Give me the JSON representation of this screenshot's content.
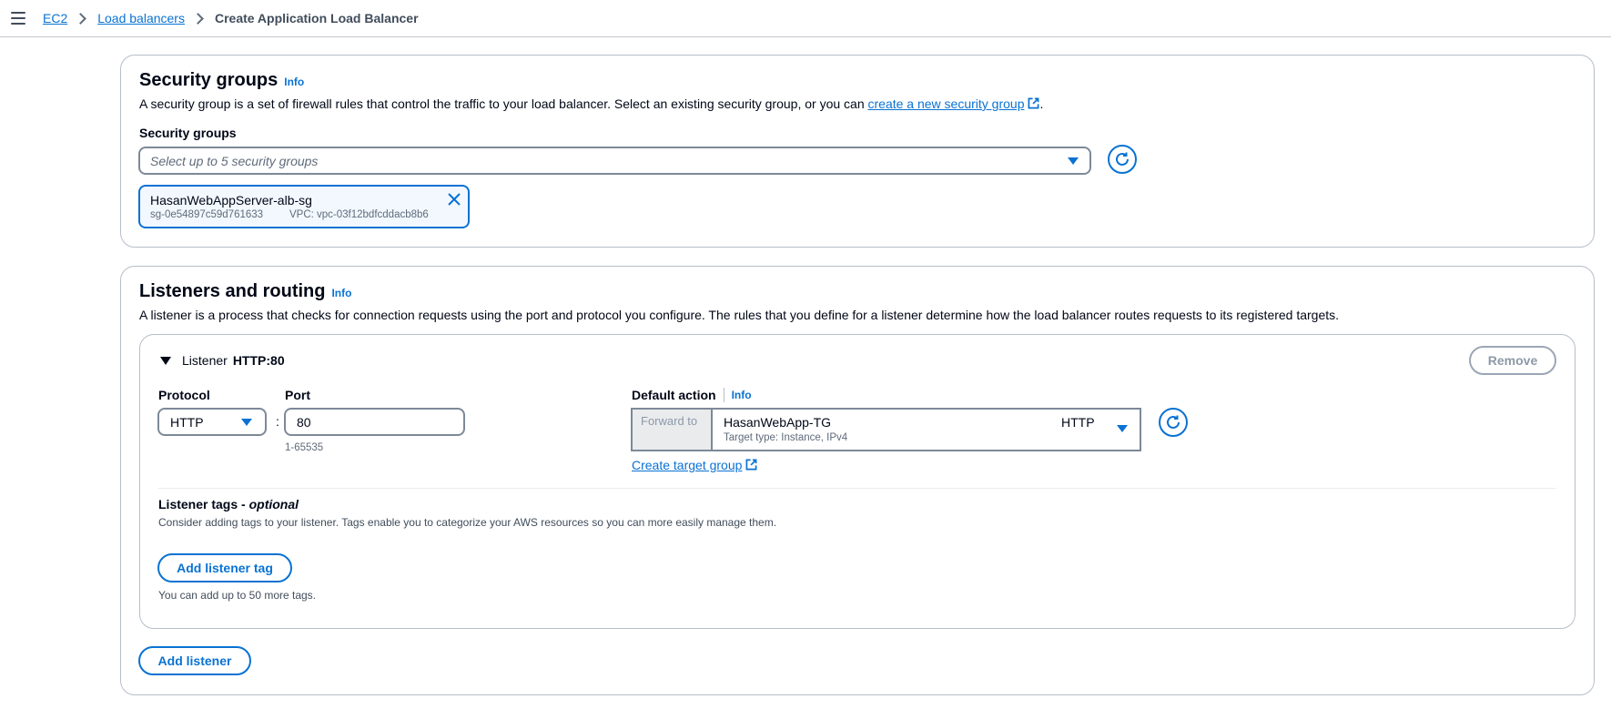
{
  "breadcrumb": {
    "items": [
      "EC2",
      "Load balancers"
    ],
    "current": "Create Application Load Balancer"
  },
  "security_groups": {
    "title": "Security groups",
    "info": "Info",
    "description_prefix": "A security group is a set of firewall rules that control the traffic to your load balancer. Select an existing security group, or you can ",
    "description_link": "create a new security group",
    "description_suffix": ".",
    "field_label": "Security groups",
    "placeholder": "Select up to 5 security groups",
    "selected": [
      {
        "name": "HasanWebAppServer-alb-sg",
        "id": "sg-0e54897c59d761633",
        "vpc": "VPC: vpc-03f12bdfcddacb8b6"
      }
    ]
  },
  "listeners": {
    "title": "Listeners and routing",
    "info": "Info",
    "description": "A listener is a process that checks for connection requests using the port and protocol you configure. The rules that you define for a listener determine how the load balancer routes requests to its registered targets.",
    "listener": {
      "prefix": "Listener",
      "name": "HTTP:80",
      "remove_label": "Remove",
      "protocol_label": "Protocol",
      "protocol_value": "HTTP",
      "colon": ":",
      "port_label": "Port",
      "port_value": "80",
      "port_hint": "1-65535",
      "default_action_label": "Default action",
      "default_action_info": "Info",
      "forward_to": "Forward to",
      "target_group_name": "HasanWebApp-TG",
      "target_group_protocol": "HTTP",
      "target_group_type": "Target type: Instance, IPv4",
      "create_target_group": "Create target group",
      "tags_title": "Listener tags",
      "tags_optional": "optional",
      "tags_separator": " - ",
      "tags_description": "Consider adding tags to your listener. Tags enable you to categorize your AWS resources so you can more easily manage them.",
      "add_tag_label": "Add listener tag",
      "tags_hint": "You can add up to 50 more tags."
    },
    "add_listener_label": "Add listener"
  },
  "colors": {
    "accent": "#0972d3",
    "border": "#b6bec9",
    "text": "#000716",
    "muted": "#5f6b7a"
  }
}
